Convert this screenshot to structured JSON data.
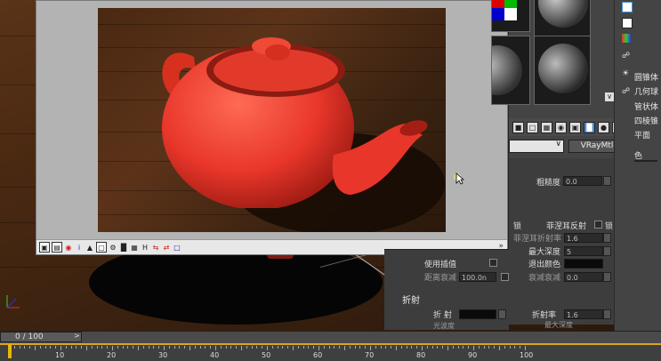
{
  "render_window": {
    "toolbar_icons": [
      "image-icon",
      "frame-icon",
      "channel-icon",
      "info-icon",
      "alpha-icon",
      "color-icon",
      "region-icon",
      "histogram-icon",
      "lut-icon",
      "h-icon",
      "link-icon",
      "compare-icon"
    ],
    "toolbar_h_label": "H",
    "expand_label": "»"
  },
  "material_editor": {
    "material_type": "VRayMtl",
    "sidebar_labels": [
      "圆锥体",
      "几何球",
      "管状体",
      "四棱锥",
      "平面"
    ],
    "sidebar_label_partial": "色",
    "glossiness_label": "粗糙度",
    "glossiness_value": "0.0",
    "lock_label": "锁",
    "fresnel_label": "菲涅耳反射",
    "lock_label_2": "锁",
    "fresnel_ior_label": "菲涅耳折射率",
    "fresnel_ior_value": "1.6",
    "max_depth_label": "最大深度",
    "max_depth_value": "5",
    "use_interp_label": "使用插值",
    "exit_color_label": "退出颜色",
    "dist_falloff_label": "距离衰减",
    "dist_falloff_value": "100.0n",
    "falloff_label": "衰减衰减",
    "falloff_value": "0.0",
    "refraction_title": "折射",
    "refraction_label": "折 射",
    "ior_label": "折射率",
    "ior_value": "1.6",
    "refl_partial_label": "光波度",
    "refl_partial_right": "最大深度"
  },
  "timeline": {
    "frame_display": "0 / 100",
    "arrow": ">",
    "ticks": [
      "10",
      "20",
      "30",
      "40",
      "50",
      "60",
      "70",
      "80",
      "90",
      "100"
    ]
  },
  "colors": {
    "teapot": "#e8362a",
    "accent": "#4a8fd6",
    "timeline_bar": "#e0a020"
  }
}
